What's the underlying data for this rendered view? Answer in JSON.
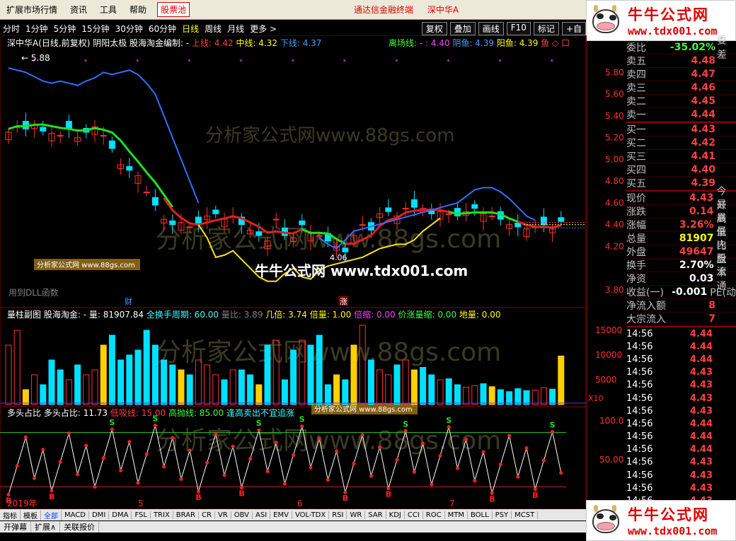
{
  "menubar": {
    "items": [
      "扩展市场行情",
      "资讯",
      "工具",
      "帮助"
    ],
    "highlight": "股票池",
    "status": "通达信金融终端",
    "stock": "深中华A"
  },
  "logo": {
    "name": "牛牛公式网",
    "url": "www.tdx001.com"
  },
  "periods": [
    "分时",
    "1分钟",
    "5分钟",
    "15分钟",
    "30分钟",
    "60分钟",
    "日线",
    "周线",
    "月线",
    "更多 >"
  ],
  "active_period": "日线",
  "toolbar_right": [
    "复权",
    "叠加",
    "画线",
    "F10",
    "标记",
    "+自"
  ],
  "main_legend": {
    "title": "深中华A(日线,前复权) 阴阳太极 股海淘金编制: -",
    "upper": "上线: 4.42",
    "middle": "中线: 4.32",
    "lower": "下线: 4.37",
    "exit": "离场线: -",
    "v1": ": 4.40",
    "yinyu": "阴鱼: 4.39",
    "yangyu": "阳鱼: 4.39",
    "fish": "鱼 ◇ 口"
  },
  "main_chart": {
    "max_label": "5.88",
    "min_label": "4.06",
    "dll": "用到DLL函数",
    "watermark": "分析家公式网www.88gs.com",
    "small_wm": "分析家公式网 www.88gs.com",
    "center_wm": "牛牛公式网 www.tdx001.com",
    "marker_cai": "财",
    "marker_zhang": "涨",
    "y_ticks": [
      "5.80",
      "5.60",
      "5.40",
      "5.20",
      "5.00",
      "4.80",
      "4.60",
      "4.40",
      "4.20",
      "3.80"
    ]
  },
  "vol_legend": {
    "title": "量柱副图",
    "author": "股海淘金: -",
    "vol": "量: 81907.84",
    "cycle": "全换手周期: 60.00",
    "ratio": "量比: 3.89",
    "times": "几倍: 3.74",
    "beiliang": "倍量: 1.00",
    "beisuo": "倍缩: 0.00",
    "jiazhang": "价涨量缩: 0.00",
    "diliang": "地量: 0.00",
    "y_ticks": [
      "15000",
      "10000",
      "5000",
      "X10"
    ]
  },
  "osc_legend": {
    "title": "多头占比",
    "value": "多头占比: 11.73",
    "low": "低吸线: 15.00",
    "high": "高抛线: 85.00",
    "note": "逢高卖出不宜追涨",
    "note2": "低吸",
    "y_ticks": [
      "100.0",
      "50.00",
      "0.00"
    ]
  },
  "xaxis": {
    "labels": [
      "2019年",
      "5",
      "6",
      "7"
    ]
  },
  "indicator_tabs": [
    "指标",
    "模板",
    "全部",
    "MACD",
    "DMI",
    "DMA",
    "FSL",
    "TRIX",
    "BRAR",
    "CR",
    "VR",
    "OBV",
    "ASI",
    "EMV",
    "VOL-TDX",
    "RSI",
    "WR",
    "SAR",
    "KDJ",
    "CCI",
    "ROC",
    "MTM",
    "BOLL",
    "PSY",
    "MCST"
  ],
  "bottom_tabs": [
    "开弹幕",
    "扩展∧",
    "关联报价"
  ],
  "quote": {
    "weibi": {
      "label": "委比",
      "value": "-35.02%",
      "extra": "委差"
    },
    "asks": [
      {
        "label": "卖五",
        "price": "4.48"
      },
      {
        "label": "卖四",
        "price": "4.47"
      },
      {
        "label": "卖三",
        "price": "4.46"
      },
      {
        "label": "卖二",
        "price": "4.45"
      },
      {
        "label": "卖一",
        "price": "4.44"
      }
    ],
    "bids": [
      {
        "label": "买一",
        "price": "4.43"
      },
      {
        "label": "买二",
        "price": "4.42"
      },
      {
        "label": "买三",
        "price": "4.41"
      },
      {
        "label": "买四",
        "price": "4.40"
      },
      {
        "label": "买五",
        "price": "4.39"
      }
    ],
    "stats": [
      {
        "label": "现价",
        "value": "4.43",
        "extra": "今开",
        "color": "red"
      },
      {
        "label": "涨跌",
        "value": "0.14",
        "extra": "最高",
        "color": "red"
      },
      {
        "label": "涨幅",
        "value": "3.26%",
        "extra": "最低",
        "color": "red"
      },
      {
        "label": "总量",
        "value": "81907",
        "extra": "量比",
        "color": "yel"
      },
      {
        "label": "外盘",
        "value": "49647",
        "extra": "内盘",
        "color": "red"
      },
      {
        "label": "换手",
        "value": "2.70%",
        "extra": "股本",
        "color": "wht"
      },
      {
        "label": "净资",
        "value": "0.03",
        "extra": "流通",
        "color": "wht"
      },
      {
        "label": "收益(一)",
        "value": "-0.001",
        "extra": "PE(动",
        "color": "wht"
      },
      {
        "label": "净流入额",
        "value": "8",
        "extra": "",
        "color": "red"
      },
      {
        "label": "大宗流入",
        "value": "7",
        "extra": "",
        "color": "red"
      }
    ],
    "trades": [
      {
        "time": "14:56",
        "price": "4.44"
      },
      {
        "time": "14:56",
        "price": "4.44"
      },
      {
        "time": "14:56",
        "price": "4.44"
      },
      {
        "time": "14:56",
        "price": "4.43"
      },
      {
        "time": "14:56",
        "price": "4.43"
      },
      {
        "time": "14:56",
        "price": "4.43"
      },
      {
        "time": "14:56",
        "price": "4.43"
      },
      {
        "time": "14:56",
        "price": "4.44"
      },
      {
        "time": "14:56",
        "price": "4.44"
      },
      {
        "time": "14:56",
        "price": "4.44"
      },
      {
        "time": "14:56",
        "price": "4.43"
      },
      {
        "time": "14:56",
        "price": "4.43"
      },
      {
        "time": "14:56",
        "price": "4.43"
      },
      {
        "time": "14:56",
        "price": "4.43"
      },
      {
        "time": "14:56",
        "price": "4.43"
      }
    ]
  }
}
